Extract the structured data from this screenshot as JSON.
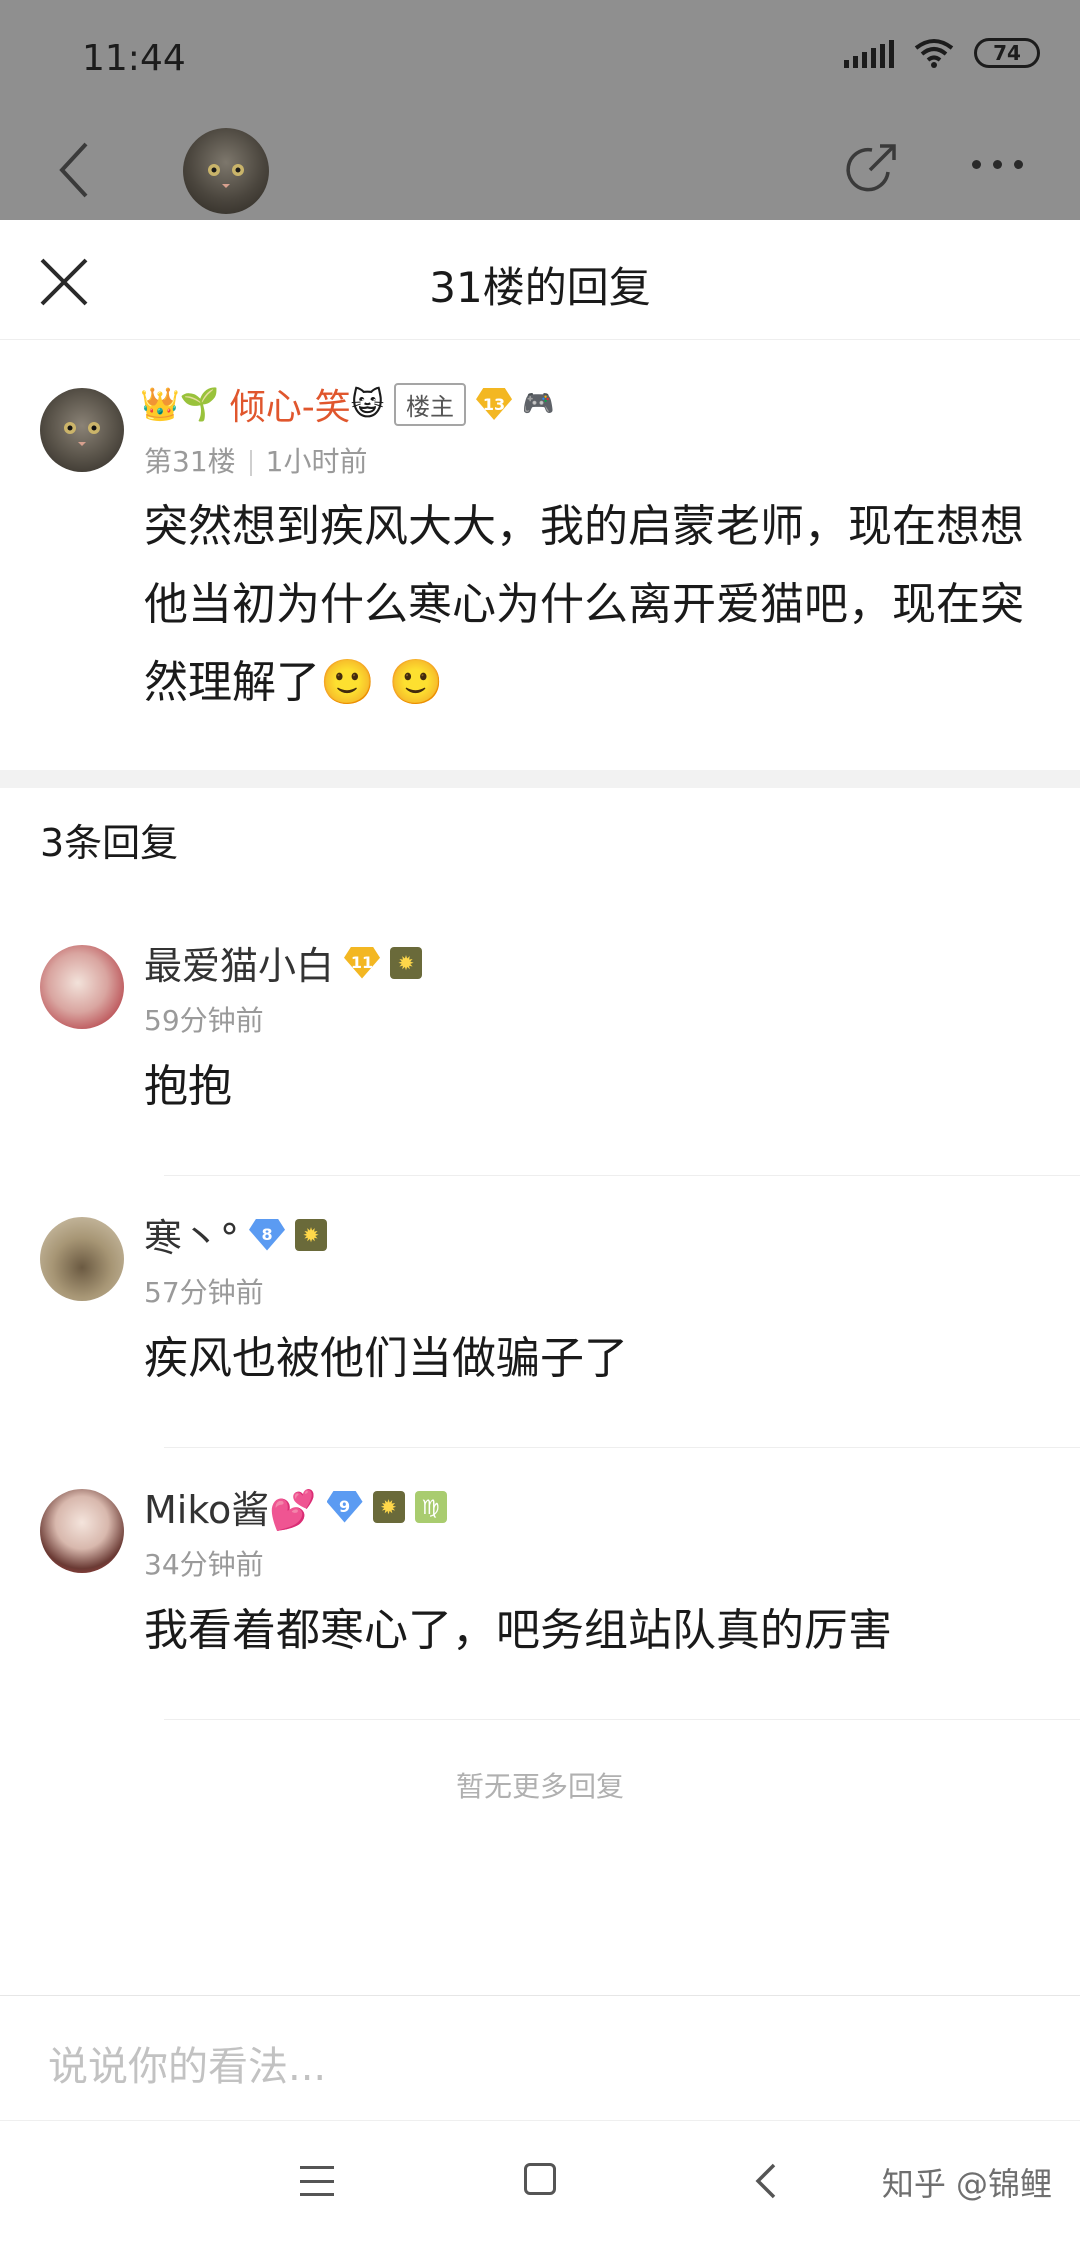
{
  "status_bar": {
    "time": "11:44",
    "battery": "74"
  },
  "top_nav": {
    "back_icon": "back-chevron-icon",
    "share_icon": "share-icon",
    "more_icon": "more-dots-icon"
  },
  "sheet": {
    "title": "31楼的回复",
    "close_icon": "close-icon"
  },
  "main_post": {
    "badge_emojis": "👑🌱",
    "author": "倾心-笑",
    "author_emoji": "😺",
    "op_tag": "楼主",
    "level": "13",
    "extra_badge": "🎮",
    "floor": "第31楼",
    "time": "1小时前",
    "text": "突然想到疾风大大，我的启蒙老师，现在想想他当初为什么寒心为什么离开爱猫吧，现在突然理解了🙂 🙂"
  },
  "reply_count": "3条回复",
  "replies": [
    {
      "name": "最爱猫小白",
      "level": "11",
      "level_color": "#f3b722",
      "badge": "✹",
      "badge2": "",
      "time": "59分钟前",
      "text": "抱抱"
    },
    {
      "name": "寒丶°",
      "level": "8",
      "level_color": "#5b9bf2",
      "badge": "✹",
      "badge2": "",
      "time": "57分钟前",
      "text": "疾风也被他们当做骗子了"
    },
    {
      "name": "Miko酱💕",
      "level": "9",
      "level_color": "#5b9bf2",
      "badge": "✹",
      "badge2": "♍",
      "time": "34分钟前",
      "text": "我看着都寒心了，吧务组站队真的厉害"
    }
  ],
  "no_more_text": "暂无更多回复",
  "input": {
    "placeholder": "说说你的看法..."
  },
  "watermark": "知乎 @锦鲤"
}
